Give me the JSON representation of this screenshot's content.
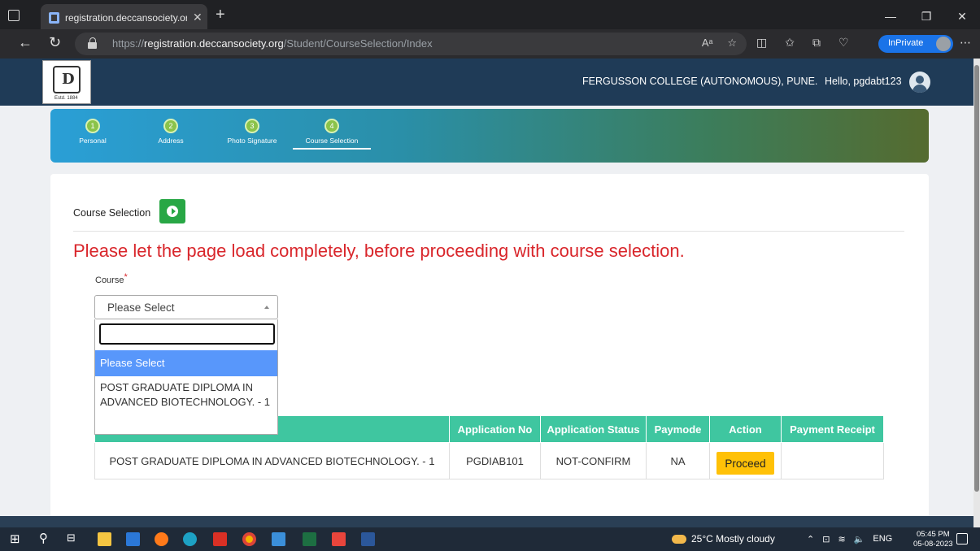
{
  "browser": {
    "tab_title": "registration.deccansociety.org/St",
    "url_prefix": "https://",
    "url_host": "registration.deccansociety.org",
    "url_path": "/Student/CourseSelection/Index",
    "inprivate_label": "InPrivate"
  },
  "header": {
    "college": "FERGUSSON COLLEGE (AUTONOMOUS), PUNE.",
    "greeting": "Hello, pgdabt123"
  },
  "steps": [
    {
      "num": "1",
      "label": "Personal"
    },
    {
      "num": "2",
      "label": "Address"
    },
    {
      "num": "3",
      "label": "Photo Signature"
    },
    {
      "num": "4",
      "label": "Course Selection"
    }
  ],
  "main": {
    "section_title": "Course Selection",
    "warning": "Please let the page load completely, before proceeding with course selection.",
    "course_label": "Course",
    "required_mark": "*",
    "select_value": "Please Select",
    "search_value": "",
    "options": [
      "Please Select",
      "POST GRADUATE DIPLOMA IN ADVANCED BIOTECHNOLOGY. - 1"
    ]
  },
  "table": {
    "headers": [
      "Application No",
      "Application Status",
      "Paymode",
      "Action",
      "Payment Receipt"
    ],
    "row": {
      "course": "POST GRADUATE DIPLOMA IN ADVANCED BIOTECHNOLOGY. - 1",
      "app_no": "PGDIAB101",
      "status": "NOT-CONFIRM",
      "paymode": "NA",
      "action": "Proceed",
      "receipt": ""
    }
  },
  "taskbar": {
    "weather": "25°C  Mostly cloudy",
    "lang": "ENG",
    "time": "05:45 PM",
    "date": "05-08-2023"
  }
}
